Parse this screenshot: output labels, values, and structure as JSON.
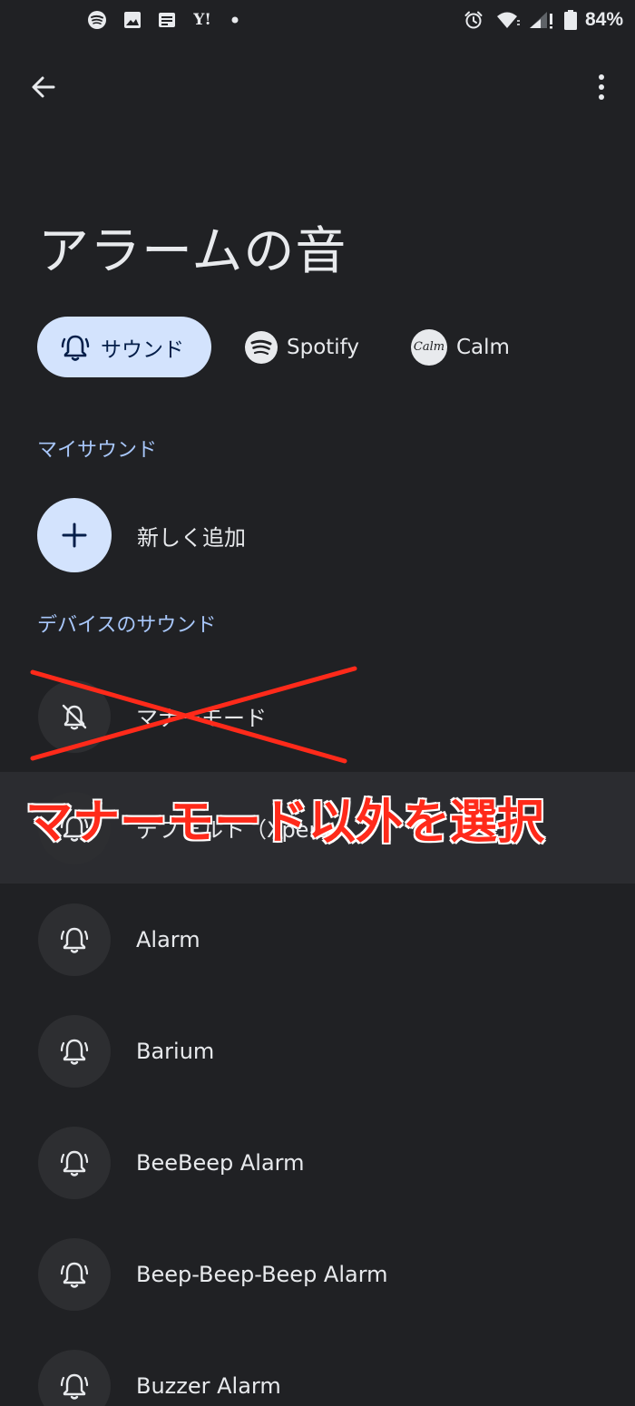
{
  "status_bar": {
    "battery": "84%",
    "icons_left": [
      "spotify-icon",
      "image-icon",
      "news-icon",
      "yahoo-icon",
      "dot-icon"
    ],
    "icons_right": [
      "alarm-icon",
      "wifi-icon",
      "signal-icon",
      "battery-icon"
    ],
    "yahoo_text": "Y!"
  },
  "toolbar": {
    "back_icon": "arrow-back-icon",
    "more_icon": "more-vert-icon"
  },
  "title": "アラームの音",
  "chips": {
    "sound": "サウンド",
    "spotify": "Spotify",
    "calm": "Calm",
    "calm_logo": "Calm"
  },
  "sections": {
    "my_sounds": "マイサウンド",
    "device_sounds": "デバイスのサウンド"
  },
  "add_new": "新しく追加",
  "sounds": [
    {
      "label": "マナーモード",
      "icon": "bell-off-icon"
    },
    {
      "label": "デフォルト（Xperia",
      "icon": "alarm-bell-icon"
    },
    {
      "label": "Alarm",
      "icon": "alarm-bell-icon"
    },
    {
      "label": "Barium",
      "icon": "alarm-bell-icon"
    },
    {
      "label": "BeeBeep Alarm",
      "icon": "alarm-bell-icon"
    },
    {
      "label": "Beep-Beep-Beep Alarm",
      "icon": "alarm-bell-icon"
    },
    {
      "label": "Buzzer Alarm",
      "icon": "alarm-bell-icon"
    }
  ],
  "annotation": {
    "text": "マナーモード以外を選択",
    "color": "#ff2a1a"
  },
  "colors": {
    "background": "#202124",
    "accent": "#a8c7fa",
    "chip_selected": "#d3e3fd"
  }
}
